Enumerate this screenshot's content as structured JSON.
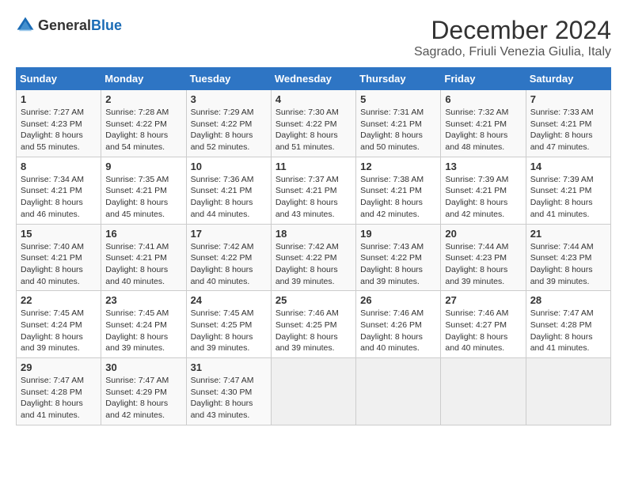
{
  "header": {
    "logo_general": "General",
    "logo_blue": "Blue",
    "title": "December 2024",
    "subtitle": "Sagrado, Friuli Venezia Giulia, Italy"
  },
  "calendar": {
    "days_of_week": [
      "Sunday",
      "Monday",
      "Tuesday",
      "Wednesday",
      "Thursday",
      "Friday",
      "Saturday"
    ],
    "weeks": [
      [
        {
          "day": "1",
          "sunrise": "Sunrise: 7:27 AM",
          "sunset": "Sunset: 4:23 PM",
          "daylight": "Daylight: 8 hours and 55 minutes."
        },
        {
          "day": "2",
          "sunrise": "Sunrise: 7:28 AM",
          "sunset": "Sunset: 4:22 PM",
          "daylight": "Daylight: 8 hours and 54 minutes."
        },
        {
          "day": "3",
          "sunrise": "Sunrise: 7:29 AM",
          "sunset": "Sunset: 4:22 PM",
          "daylight": "Daylight: 8 hours and 52 minutes."
        },
        {
          "day": "4",
          "sunrise": "Sunrise: 7:30 AM",
          "sunset": "Sunset: 4:22 PM",
          "daylight": "Daylight: 8 hours and 51 minutes."
        },
        {
          "day": "5",
          "sunrise": "Sunrise: 7:31 AM",
          "sunset": "Sunset: 4:21 PM",
          "daylight": "Daylight: 8 hours and 50 minutes."
        },
        {
          "day": "6",
          "sunrise": "Sunrise: 7:32 AM",
          "sunset": "Sunset: 4:21 PM",
          "daylight": "Daylight: 8 hours and 48 minutes."
        },
        {
          "day": "7",
          "sunrise": "Sunrise: 7:33 AM",
          "sunset": "Sunset: 4:21 PM",
          "daylight": "Daylight: 8 hours and 47 minutes."
        }
      ],
      [
        {
          "day": "8",
          "sunrise": "Sunrise: 7:34 AM",
          "sunset": "Sunset: 4:21 PM",
          "daylight": "Daylight: 8 hours and 46 minutes."
        },
        {
          "day": "9",
          "sunrise": "Sunrise: 7:35 AM",
          "sunset": "Sunset: 4:21 PM",
          "daylight": "Daylight: 8 hours and 45 minutes."
        },
        {
          "day": "10",
          "sunrise": "Sunrise: 7:36 AM",
          "sunset": "Sunset: 4:21 PM",
          "daylight": "Daylight: 8 hours and 44 minutes."
        },
        {
          "day": "11",
          "sunrise": "Sunrise: 7:37 AM",
          "sunset": "Sunset: 4:21 PM",
          "daylight": "Daylight: 8 hours and 43 minutes."
        },
        {
          "day": "12",
          "sunrise": "Sunrise: 7:38 AM",
          "sunset": "Sunset: 4:21 PM",
          "daylight": "Daylight: 8 hours and 42 minutes."
        },
        {
          "day": "13",
          "sunrise": "Sunrise: 7:39 AM",
          "sunset": "Sunset: 4:21 PM",
          "daylight": "Daylight: 8 hours and 42 minutes."
        },
        {
          "day": "14",
          "sunrise": "Sunrise: 7:39 AM",
          "sunset": "Sunset: 4:21 PM",
          "daylight": "Daylight: 8 hours and 41 minutes."
        }
      ],
      [
        {
          "day": "15",
          "sunrise": "Sunrise: 7:40 AM",
          "sunset": "Sunset: 4:21 PM",
          "daylight": "Daylight: 8 hours and 40 minutes."
        },
        {
          "day": "16",
          "sunrise": "Sunrise: 7:41 AM",
          "sunset": "Sunset: 4:21 PM",
          "daylight": "Daylight: 8 hours and 40 minutes."
        },
        {
          "day": "17",
          "sunrise": "Sunrise: 7:42 AM",
          "sunset": "Sunset: 4:22 PM",
          "daylight": "Daylight: 8 hours and 40 minutes."
        },
        {
          "day": "18",
          "sunrise": "Sunrise: 7:42 AM",
          "sunset": "Sunset: 4:22 PM",
          "daylight": "Daylight: 8 hours and 39 minutes."
        },
        {
          "day": "19",
          "sunrise": "Sunrise: 7:43 AM",
          "sunset": "Sunset: 4:22 PM",
          "daylight": "Daylight: 8 hours and 39 minutes."
        },
        {
          "day": "20",
          "sunrise": "Sunrise: 7:44 AM",
          "sunset": "Sunset: 4:23 PM",
          "daylight": "Daylight: 8 hours and 39 minutes."
        },
        {
          "day": "21",
          "sunrise": "Sunrise: 7:44 AM",
          "sunset": "Sunset: 4:23 PM",
          "daylight": "Daylight: 8 hours and 39 minutes."
        }
      ],
      [
        {
          "day": "22",
          "sunrise": "Sunrise: 7:45 AM",
          "sunset": "Sunset: 4:24 PM",
          "daylight": "Daylight: 8 hours and 39 minutes."
        },
        {
          "day": "23",
          "sunrise": "Sunrise: 7:45 AM",
          "sunset": "Sunset: 4:24 PM",
          "daylight": "Daylight: 8 hours and 39 minutes."
        },
        {
          "day": "24",
          "sunrise": "Sunrise: 7:45 AM",
          "sunset": "Sunset: 4:25 PM",
          "daylight": "Daylight: 8 hours and 39 minutes."
        },
        {
          "day": "25",
          "sunrise": "Sunrise: 7:46 AM",
          "sunset": "Sunset: 4:25 PM",
          "daylight": "Daylight: 8 hours and 39 minutes."
        },
        {
          "day": "26",
          "sunrise": "Sunrise: 7:46 AM",
          "sunset": "Sunset: 4:26 PM",
          "daylight": "Daylight: 8 hours and 40 minutes."
        },
        {
          "day": "27",
          "sunrise": "Sunrise: 7:46 AM",
          "sunset": "Sunset: 4:27 PM",
          "daylight": "Daylight: 8 hours and 40 minutes."
        },
        {
          "day": "28",
          "sunrise": "Sunrise: 7:47 AM",
          "sunset": "Sunset: 4:28 PM",
          "daylight": "Daylight: 8 hours and 41 minutes."
        }
      ],
      [
        {
          "day": "29",
          "sunrise": "Sunrise: 7:47 AM",
          "sunset": "Sunset: 4:28 PM",
          "daylight": "Daylight: 8 hours and 41 minutes."
        },
        {
          "day": "30",
          "sunrise": "Sunrise: 7:47 AM",
          "sunset": "Sunset: 4:29 PM",
          "daylight": "Daylight: 8 hours and 42 minutes."
        },
        {
          "day": "31",
          "sunrise": "Sunrise: 7:47 AM",
          "sunset": "Sunset: 4:30 PM",
          "daylight": "Daylight: 8 hours and 43 minutes."
        },
        null,
        null,
        null,
        null
      ]
    ]
  }
}
